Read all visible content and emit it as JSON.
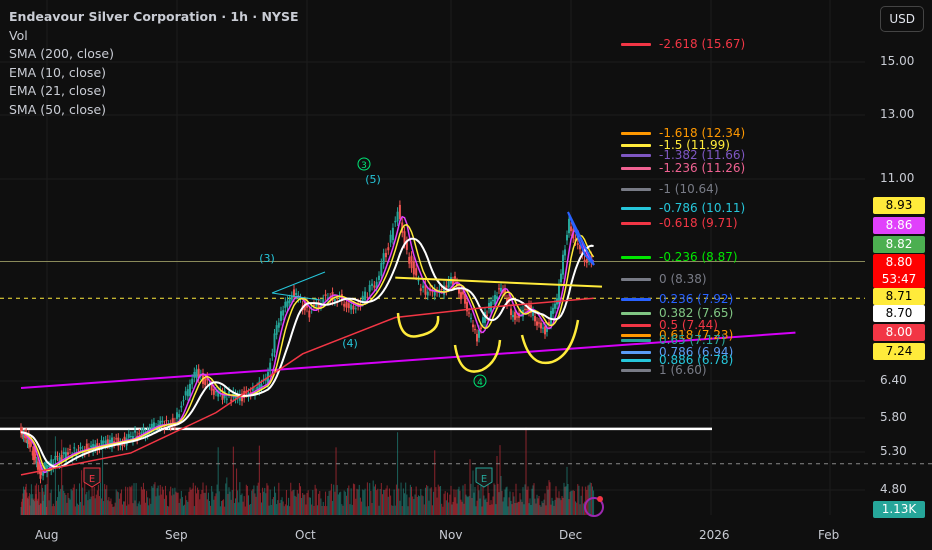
{
  "header": {
    "title": "Endeavour Silver Corporation · 1h · NYSE",
    "indicators": [
      "Vol",
      "SMA (200, close)",
      "EMA (10, close)",
      "EMA (21, close)",
      "SMA (50, close)"
    ],
    "currency": "USD"
  },
  "price_axis": [
    "15.00",
    "13.00",
    "11.00",
    "6.40",
    "5.80",
    "5.30",
    "4.80"
  ],
  "time_axis": [
    "Aug",
    "Sep",
    "Oct",
    "Nov",
    "Dec",
    "2026",
    "Feb"
  ],
  "price_tags": [
    {
      "text": "8.93",
      "bg": "#ffeb3b",
      "fg": "#000"
    },
    {
      "text": "8.86",
      "bg": "#e040fb",
      "fg": "#fff"
    },
    {
      "text": "8.82",
      "bg": "#4caf50",
      "fg": "#fff"
    },
    {
      "text": "8.80",
      "bg": "#ff0000",
      "fg": "#fff",
      "sub": "53:47"
    },
    {
      "text": "8.71",
      "bg": "#ffeb3b",
      "fg": "#000"
    },
    {
      "text": "8.70",
      "bg": "#ffffff",
      "fg": "#000"
    },
    {
      "text": "8.00",
      "bg": "#f23645",
      "fg": "#fff"
    },
    {
      "text": "7.24",
      "bg": "#ffeb3b",
      "fg": "#000"
    }
  ],
  "volume_tag": "1.13K",
  "fib_levels": [
    {
      "label": "-2.618 (15.67)",
      "color": "#f23645"
    },
    {
      "label": "-1.618 (12.34)",
      "color": "#ff9800"
    },
    {
      "label": "-1.5 (11.99)",
      "color": "#ffeb3b"
    },
    {
      "label": "-1.382 (11.66)",
      "color": "#7e57c2"
    },
    {
      "label": "-1.236 (11.26)",
      "color": "#f06292"
    },
    {
      "label": "-1 (10.64)",
      "color": "#787b86"
    },
    {
      "label": "-0.786 (10.11)",
      "color": "#26c6da"
    },
    {
      "label": "-0.618 (9.71)",
      "color": "#f23645"
    },
    {
      "label": "-0.236 (8.87)",
      "color": "#00e600"
    },
    {
      "label": "0 (8.38)",
      "color": "#787b86"
    },
    {
      "label": "0.236 (7.92)",
      "color": "#2962ff"
    },
    {
      "label": "0.382 (7.65)",
      "color": "#81c784"
    },
    {
      "label": "0.5 (7.44)",
      "color": "#f23645"
    },
    {
      "label": "0.618 (7.23)",
      "color": "#ff9800"
    },
    {
      "label": "0.65 (7.17)",
      "color": "#26a69a"
    },
    {
      "label": "0.786 (6.94)",
      "color": "#5b9cf6"
    },
    {
      "label": "0.886 (6.78)",
      "color": "#26c6da"
    },
    {
      "label": "1 (6.60)",
      "color": "#787b86"
    }
  ],
  "wave_labels": [
    {
      "text": "3",
      "circled": true,
      "color": "#00e676"
    },
    {
      "text": "(5)",
      "color": "#26c6da"
    },
    {
      "text": "(3)",
      "color": "#26c6da"
    },
    {
      "text": "(4)",
      "color": "#26c6da"
    },
    {
      "text": "4",
      "circled": true,
      "color": "#00e676"
    }
  ],
  "events": [
    {
      "icon": "earnings-icon",
      "text": "E"
    },
    {
      "icon": "earnings-icon",
      "text": "E"
    },
    {
      "icon": "dividend-flash-icon"
    }
  ],
  "chart_data": {
    "type": "line",
    "title": "Endeavour Silver Corporation · 1h · NYSE",
    "x_unit": "days since Aug 1 2025",
    "scale": "log",
    "ylim": [
      4.8,
      15.0
    ],
    "price": [
      [
        -10,
        5.6
      ],
      [
        -6,
        5.45
      ],
      [
        -2,
        5.0
      ],
      [
        0,
        5.1
      ],
      [
        6,
        5.3
      ],
      [
        12,
        5.4
      ],
      [
        20,
        5.5
      ],
      [
        26,
        5.7
      ],
      [
        31,
        5.75
      ],
      [
        36,
        6.6
      ],
      [
        40,
        6.2
      ],
      [
        46,
        6.15
      ],
      [
        52,
        6.4
      ],
      [
        55,
        7.6
      ],
      [
        58,
        8.1
      ],
      [
        62,
        7.7
      ],
      [
        66,
        8.1
      ],
      [
        72,
        7.8
      ],
      [
        76,
        8.3
      ],
      [
        79,
        9.2
      ],
      [
        81,
        10.2
      ],
      [
        83,
        9.0
      ],
      [
        86,
        8.2
      ],
      [
        90,
        8.1
      ],
      [
        93,
        8.4
      ],
      [
        96,
        7.9
      ],
      [
        99,
        7.2
      ],
      [
        102,
        7.8
      ],
      [
        105,
        8.3
      ],
      [
        108,
        7.6
      ],
      [
        112,
        7.8
      ],
      [
        116,
        7.3
      ],
      [
        119,
        8.0
      ],
      [
        122,
        9.8
      ],
      [
        125,
        8.9
      ],
      [
        127,
        8.8
      ]
    ],
    "sma200": [
      [
        -10,
        5.0
      ],
      [
        20,
        5.3
      ],
      [
        40,
        5.9
      ],
      [
        60,
        6.9
      ],
      [
        80,
        7.6
      ],
      [
        100,
        7.8
      ],
      [
        127,
        8.0
      ]
    ],
    "trendline_magenta": [
      [
        -10,
        6.3
      ],
      [
        175,
        7.3
      ]
    ],
    "support_white": 5.65,
    "neckline_yellow": [
      [
        80,
        8.45
      ],
      [
        127,
        8.25
      ]
    ],
    "last_price": 8.8
  }
}
